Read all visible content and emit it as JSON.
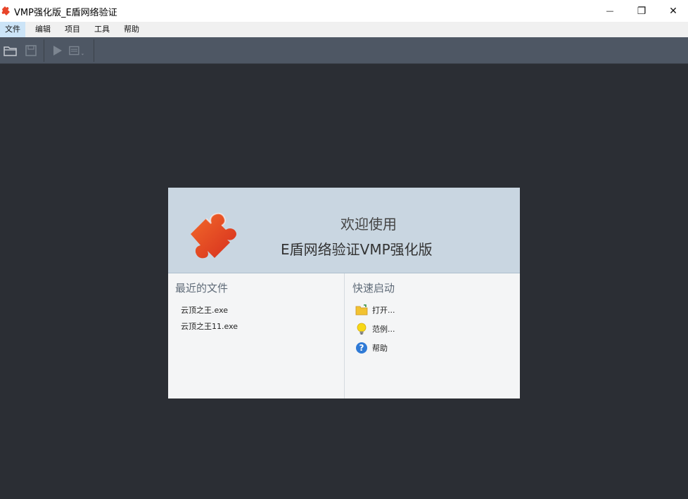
{
  "window": {
    "title": "VMP强化版_E盾网络验证",
    "minimize_glyph": "—",
    "maximize_glyph": "❐",
    "close_glyph": "✕"
  },
  "menu": {
    "items": [
      {
        "label": "文件"
      },
      {
        "label": "编辑"
      },
      {
        "label": "项目"
      },
      {
        "label": "工具"
      },
      {
        "label": "帮助"
      }
    ]
  },
  "toolbar": {
    "icons": [
      "open-folder-icon",
      "save-icon",
      "run-icon",
      "compile-menu-icon"
    ]
  },
  "welcome": {
    "line1": "欢迎使用",
    "line2": "E盾网络验证VMP强化版",
    "recent_title": "最近的文件",
    "recent_files": [
      {
        "name": "云顶之王.exe"
      },
      {
        "name": "云顶之王11.exe"
      }
    ],
    "quick_title": "快速启动",
    "quick_actions": [
      {
        "label": "打开...",
        "icon": "folder-icon"
      },
      {
        "label": "范例...",
        "icon": "lightbulb-icon"
      },
      {
        "label": "帮助",
        "icon": "help-icon"
      }
    ]
  },
  "colors": {
    "background": "#2b2e34",
    "toolbar": "#4e5764",
    "header": "#c9d6e1",
    "accent_red": "#e8452a"
  }
}
